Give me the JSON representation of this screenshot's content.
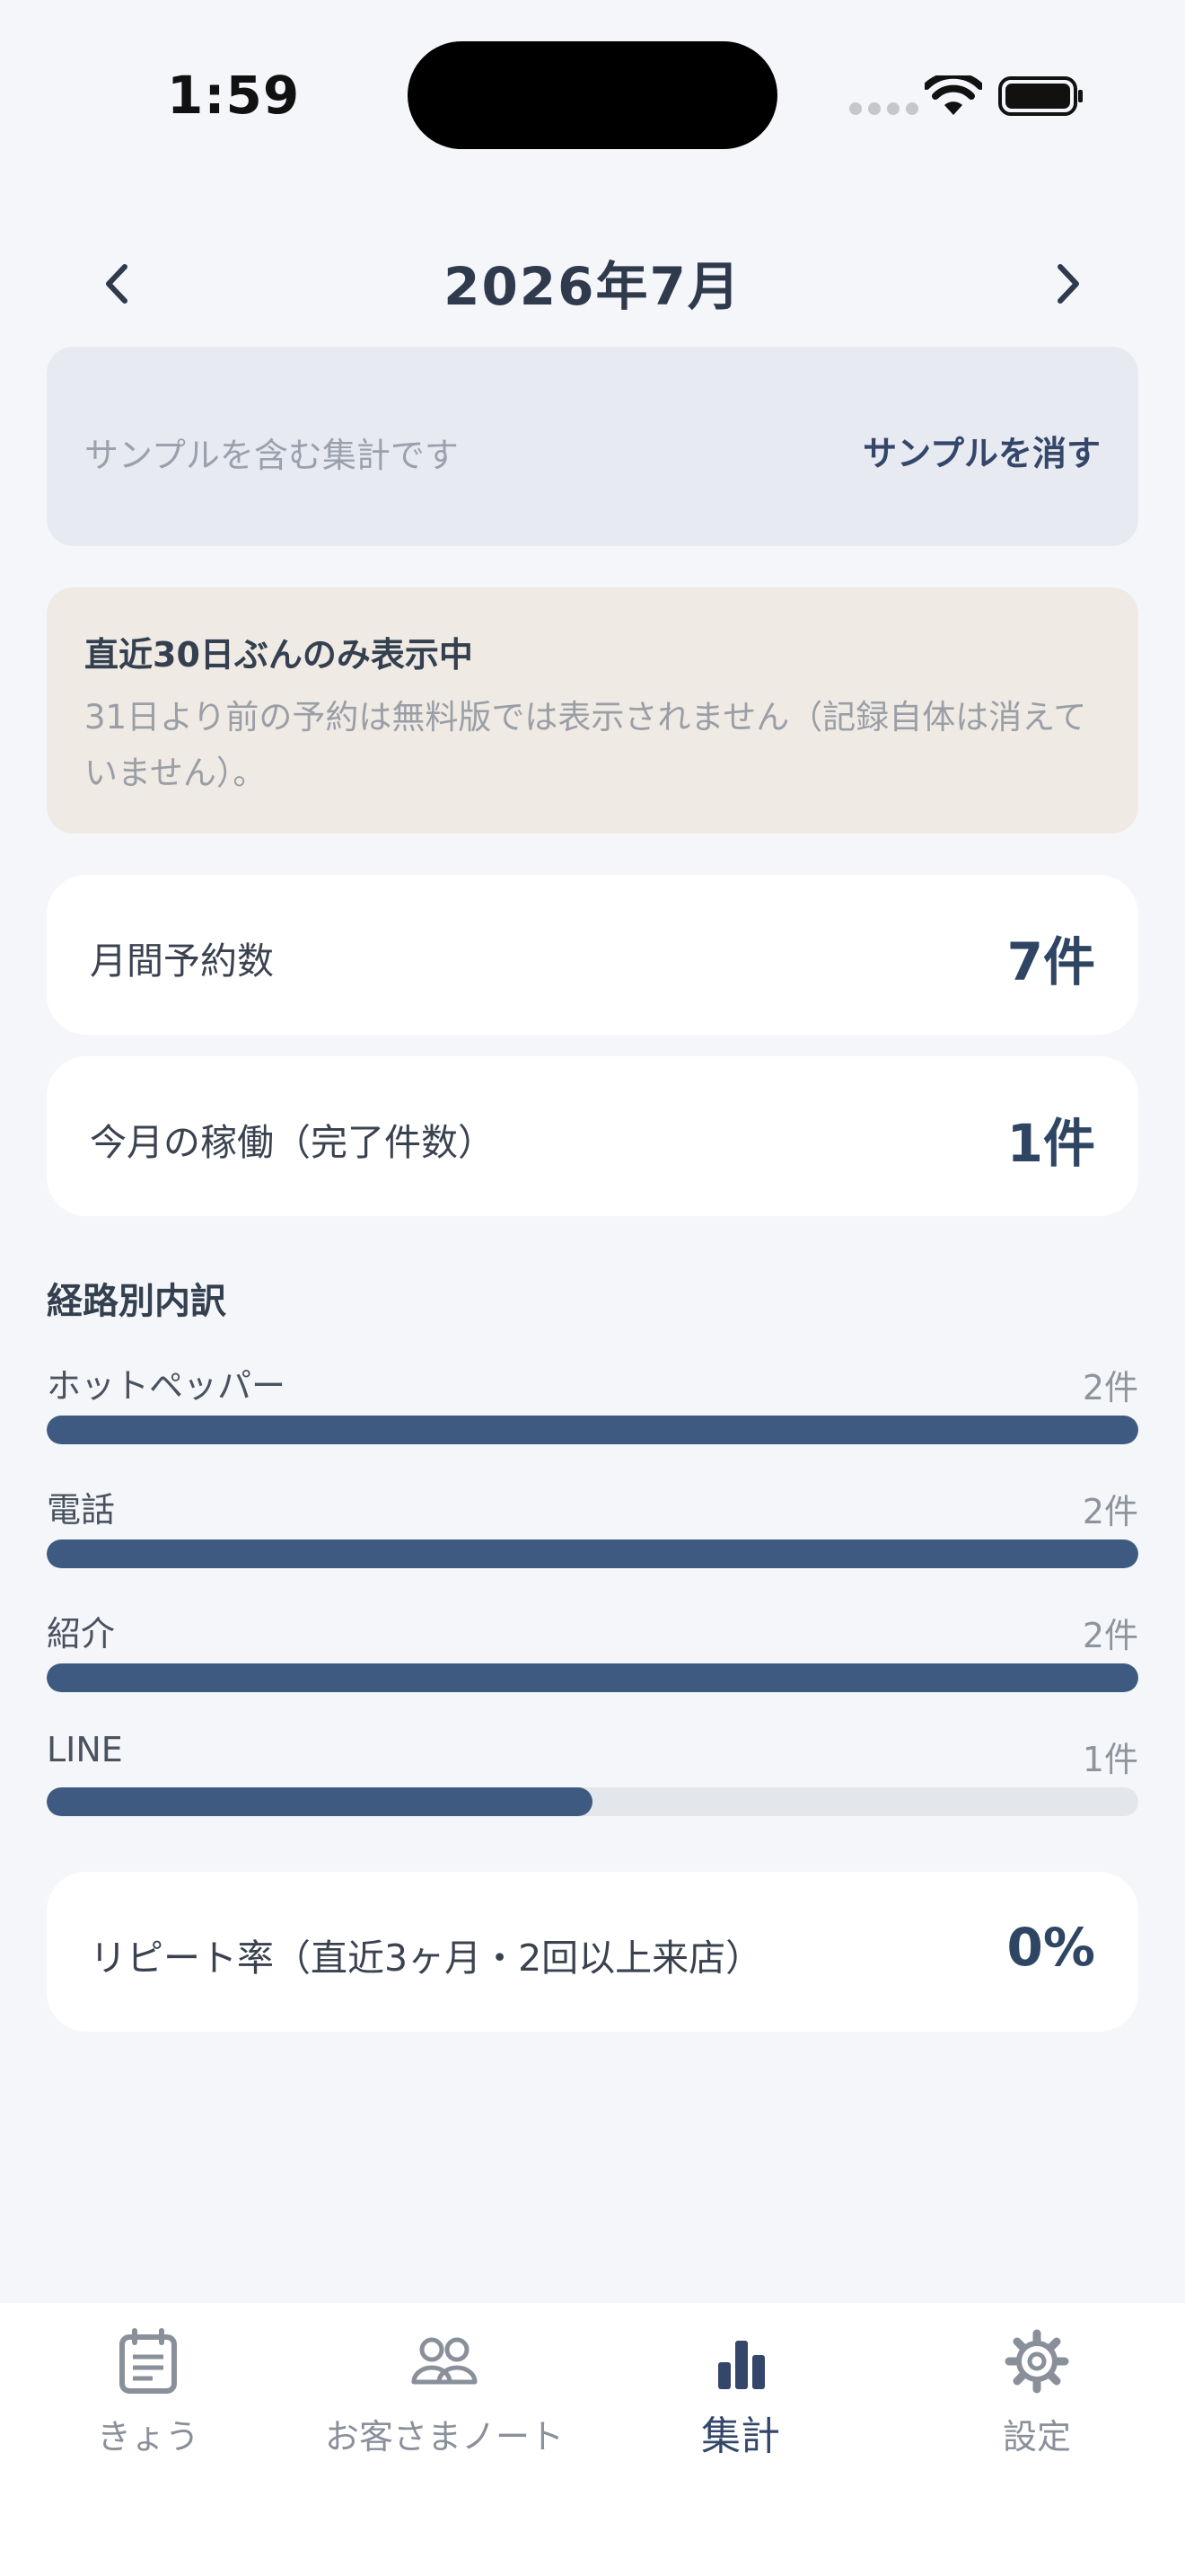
{
  "status": {
    "time": "1:59"
  },
  "header": {
    "title": "2026年7月"
  },
  "sample_banner": {
    "text": "サンプルを含む集計です",
    "action": "サンプルを消す"
  },
  "notice": {
    "title": "直近30日ぶんのみ表示中",
    "body": "31日より前の予約は無料版では表示されません（記録自体は消えていません）。"
  },
  "stats": {
    "monthly_label": "月間予約数",
    "monthly_value": "7件",
    "done_label": "今月の稼働（完了件数）",
    "done_value": "1件",
    "repeat_label": "リピート率（直近3ヶ月・2回以上来店）",
    "repeat_value": "0%"
  },
  "breakdown": {
    "title": "経路別内訳",
    "items": [
      {
        "label": "ホットペッパー",
        "count": "2件",
        "ratio": 1.0
      },
      {
        "label": "電話",
        "count": "2件",
        "ratio": 1.0
      },
      {
        "label": "紹介",
        "count": "2件",
        "ratio": 1.0
      },
      {
        "label": "LINE",
        "count": "1件",
        "ratio": 0.5
      }
    ]
  },
  "tabs": [
    {
      "label": "きょう",
      "icon": "calendar-note-icon"
    },
    {
      "label": "お客さまノート",
      "icon": "people-icon"
    },
    {
      "label": "集計",
      "icon": "bar-chart-icon",
      "active": true
    },
    {
      "label": "設定",
      "icon": "gear-icon"
    }
  ],
  "colors": {
    "accent": "#3e5a80",
    "background": "#f4f6fa",
    "track": "#e3e6eb"
  }
}
